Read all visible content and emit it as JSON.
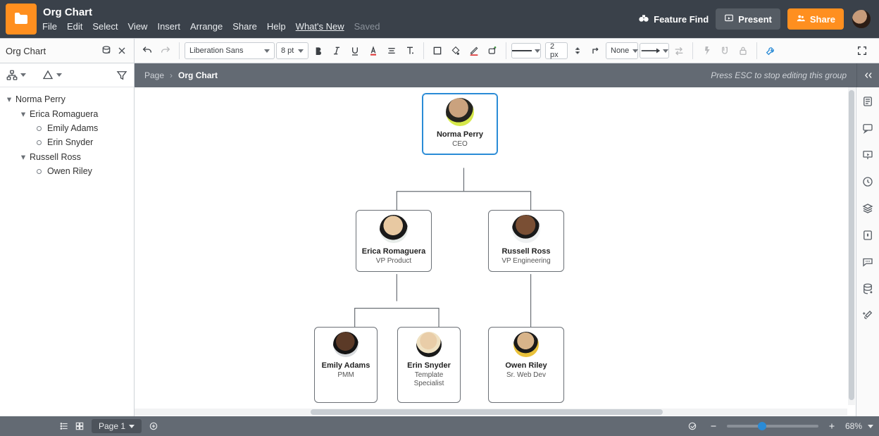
{
  "doc": {
    "title": "Org Chart",
    "saved_label": "Saved"
  },
  "menu": {
    "file": "File",
    "edit": "Edit",
    "select": "Select",
    "view": "View",
    "insert": "Insert",
    "arrange": "Arrange",
    "share": "Share",
    "help": "Help",
    "whatsnew": "What's New"
  },
  "header": {
    "feature_find": "Feature Find",
    "present": "Present",
    "share": "Share"
  },
  "toolbar_left": {
    "title": "Org Chart"
  },
  "format": {
    "font": "Liberation Sans",
    "size_label": "8 pt",
    "linewidth": "2 px",
    "arrow_fill": "None"
  },
  "breadcrumb": {
    "page": "Page",
    "current": "Org Chart",
    "esc_hint": "Press ESC to stop editing this group"
  },
  "tree": {
    "root": "Norma Perry",
    "children": [
      {
        "name": "Erica Romaguera",
        "children": [
          "Emily Adams",
          "Erin Snyder"
        ]
      },
      {
        "name": "Russell Ross",
        "children": [
          "Owen Riley"
        ]
      }
    ]
  },
  "org": {
    "norma": {
      "name": "Norma Perry",
      "role": "CEO"
    },
    "erica": {
      "name": "Erica Romaguera",
      "role": "VP Product"
    },
    "russell": {
      "name": "Russell Ross",
      "role": "VP Engineering"
    },
    "emily": {
      "name": "Emily Adams",
      "role": "PMM"
    },
    "erin": {
      "name": "Erin Snyder",
      "role": "Template Specialist"
    },
    "owen": {
      "name": "Owen Riley",
      "role": "Sr. Web Dev"
    }
  },
  "footer": {
    "page_label": "Page 1",
    "zoom_label": "68%",
    "zoom_pct": 68
  }
}
